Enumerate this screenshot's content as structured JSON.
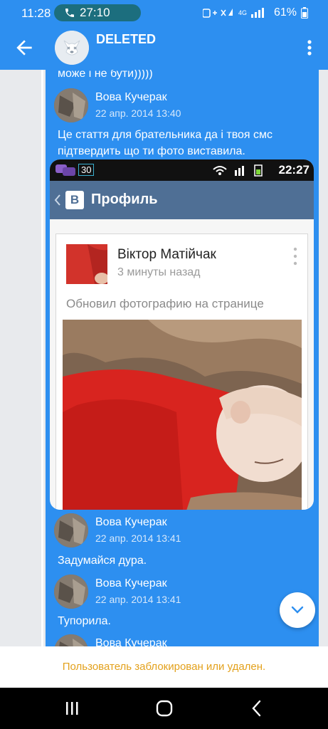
{
  "status_bar": {
    "time": "11:28",
    "call_time": "27:10",
    "battery": "61%",
    "network": "4G"
  },
  "chat": {
    "title": "DELETED"
  },
  "messages": [
    {
      "fragment": "може і не бути)))))"
    },
    {
      "author": "Вова Кучерак",
      "time": "22 апр. 2014 13:40",
      "text": "Це стаття для брательника да і твоя смс підтвердить що ти фото виставила."
    },
    {
      "author": "Вова Кучерак",
      "time": "22 апр. 2014 13:41",
      "text": "Задумайся дура."
    },
    {
      "author": "Вова Кучерак",
      "time": "22 апр. 2014 13:41",
      "text": "Тупорила."
    },
    {
      "author": "Вова Кучерак"
    }
  ],
  "attachment": {
    "status_badge": "30",
    "status_time": "22:27",
    "logo_letter": "B",
    "bar_title": "Профиль",
    "post_author": "Віктор Матійчак",
    "post_time": "3 минуты назад",
    "post_status": "Обновил фотографию на странице"
  },
  "notice": {
    "text": "Пользователь заблокирован или удален."
  },
  "colors": {
    "accent": "#2d8ff0",
    "notice_text": "#e3a11c",
    "background": "#e8eaed"
  },
  "icons": [
    "back-arrow-icon",
    "overflow-menu-icon",
    "phone-icon",
    "chevron-down-icon",
    "recents-icon",
    "home-icon",
    "nav-back-icon"
  ]
}
